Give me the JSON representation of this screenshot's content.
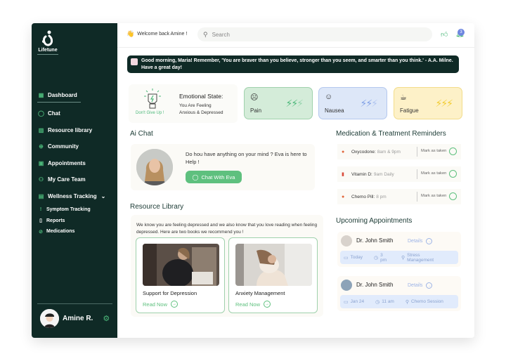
{
  "app": {
    "logo_text": "Lifetune"
  },
  "sidebar": {
    "items": [
      {
        "label": "Dashboard",
        "icon": "dashboard-icon",
        "active": true
      },
      {
        "label": "Chat",
        "icon": "chat-bubble-icon"
      },
      {
        "label": "Resource library",
        "icon": "books-icon"
      },
      {
        "label": "Community",
        "icon": "globe-icon"
      },
      {
        "label": "Appointments",
        "icon": "calendar-icon"
      },
      {
        "label": "My Care Team",
        "icon": "users-icon"
      },
      {
        "label": "Wellness Tracking",
        "icon": "wellness-icon",
        "expanded": true
      }
    ],
    "sub_items": [
      {
        "label": "Symptom Tracking",
        "icon": "thermometer-icon"
      },
      {
        "label": "Reports",
        "icon": "document-icon"
      },
      {
        "label": "Medications",
        "icon": "pill-icon"
      }
    ],
    "user": {
      "name": "Amine R.",
      "settings_icon": "gear-icon"
    }
  },
  "header": {
    "welcome": "Welcome back Amine !",
    "search_placeholder": "Search",
    "notification_count": "3"
  },
  "quote": {
    "text": "Good morning, Maria! Remember, 'You are braver than you believe, stronger than you seem, and smarter than you think.' - A.A. Milne. Have a great day!"
  },
  "emotional": {
    "motto": "Don't Give Up !",
    "title": "Emotional State:",
    "line1": "You Are Feeling",
    "line2": "Anxious & Depressed"
  },
  "symptoms": [
    {
      "label": "Pain",
      "level": 2,
      "max": 3,
      "color": "#4cb87a"
    },
    {
      "label": "Nausea",
      "level": 2,
      "max": 3,
      "color": "#7f9fe6"
    },
    {
      "label": "Fatigue",
      "level": 3,
      "max": 3,
      "color": "#f2cc30"
    }
  ],
  "ai_chat": {
    "title": "Ai Chat",
    "question": "Do hou have anything on your mind ? Eva is here to Help !",
    "button": "Chat With Eva"
  },
  "resources": {
    "title": "Resource Library",
    "description": "We know you are feeling depressed and we also know that you love reading when feeling depressed. Here are two books we recommend you !",
    "books": [
      {
        "title": "Support for Depression",
        "cta": "Read Now"
      },
      {
        "title": "Anxiety Management",
        "cta": "Read Now"
      }
    ]
  },
  "medications": {
    "title": "Medication & Treatment Reminders",
    "items": [
      {
        "name": "Oxycodone:",
        "time": "8am & 9pm",
        "action": "Mark as taken"
      },
      {
        "name": "Vitamin D:",
        "time": "9am Daily",
        "action": "Mark as taken"
      },
      {
        "name": "Chemo Pill:",
        "time": "8 pm",
        "action": "Mark as taken"
      }
    ]
  },
  "appointments": {
    "title": "Upcoming Appointments",
    "items": [
      {
        "doctor": "Dr. John Smith",
        "details": "Details",
        "date": "Today",
        "time": "3 pm",
        "type": "Stress Management"
      },
      {
        "doctor": "Dr. John Smith",
        "details": "Details",
        "date": "Jan 24",
        "time": "11 am",
        "type": "Chemo Session"
      }
    ]
  }
}
